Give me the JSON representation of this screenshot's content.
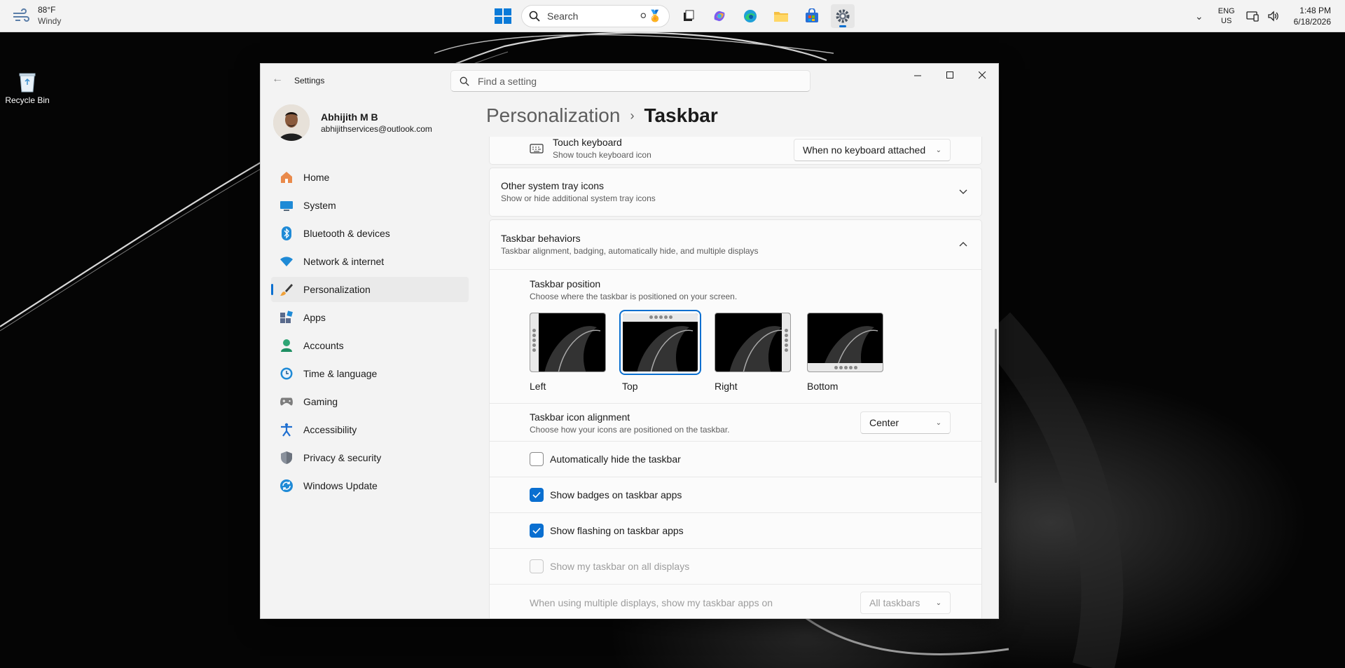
{
  "taskbar": {
    "weather": {
      "temp": "88°F",
      "condition": "Windy",
      "icon": "wind-icon"
    },
    "search_label": "Search",
    "apps": [
      "start-icon",
      "file-viewer-icon",
      "copilot-icon",
      "edge-icon",
      "file-explorer-icon",
      "store-icon",
      "settings-icon"
    ],
    "language": {
      "line1": "ENG",
      "line2": "US"
    },
    "clock": {
      "time": "1:48 PM",
      "date": "6/18/2026"
    }
  },
  "desktop": {
    "recycle_bin_label": "Recycle Bin"
  },
  "window": {
    "app_title": "Settings",
    "search_placeholder": "Find a setting"
  },
  "profile": {
    "name": "Abhijith M B",
    "email": "abhijithservices@outlook.com"
  },
  "nav": {
    "items": [
      {
        "label": "Home",
        "icon": "home-icon",
        "color": "#e66b2b"
      },
      {
        "label": "System",
        "icon": "system-icon",
        "color": "#1f8ad6"
      },
      {
        "label": "Bluetooth & devices",
        "icon": "bluetooth-icon",
        "color": "#1f8ad6"
      },
      {
        "label": "Network & internet",
        "icon": "wifi-icon",
        "color": "#1f8ad6"
      },
      {
        "label": "Personalization",
        "icon": "brush-icon",
        "color": "#e89a3a"
      },
      {
        "label": "Apps",
        "icon": "apps-icon",
        "color": "#5a6b8c"
      },
      {
        "label": "Accounts",
        "icon": "accounts-icon",
        "color": "#2ea574"
      },
      {
        "label": "Time & language",
        "icon": "clock-icon",
        "color": "#1f8ad6"
      },
      {
        "label": "Gaming",
        "icon": "gamepad-icon",
        "color": "#7d7d7d"
      },
      {
        "label": "Accessibility",
        "icon": "accessibility-icon",
        "color": "#1f6fd0"
      },
      {
        "label": "Privacy & security",
        "icon": "shield-icon",
        "color": "#7d8591"
      },
      {
        "label": "Windows Update",
        "icon": "update-icon",
        "color": "#1f8ad6"
      }
    ],
    "selected_index": 4
  },
  "breadcrumb": {
    "parent": "Personalization",
    "current": "Taskbar"
  },
  "touch_keyboard": {
    "title": "Touch keyboard",
    "subtitle": "Show touch keyboard icon",
    "value": "When no keyboard attached"
  },
  "other_tray": {
    "title": "Other system tray icons",
    "subtitle": "Show or hide additional system tray icons"
  },
  "behaviors": {
    "title": "Taskbar behaviors",
    "subtitle": "Taskbar alignment, badging, automatically hide, and multiple displays",
    "position": {
      "title": "Taskbar position",
      "subtitle": "Choose where the taskbar is positioned on your screen.",
      "options": [
        "Left",
        "Top",
        "Right",
        "Bottom"
      ],
      "selected": "Top"
    },
    "alignment": {
      "title": "Taskbar icon alignment",
      "subtitle": "Choose how your icons are positioned on the taskbar.",
      "value": "Center"
    },
    "auto_hide": {
      "label": "Automatically hide the taskbar",
      "checked": false
    },
    "badges": {
      "label": "Show badges on taskbar apps",
      "checked": true
    },
    "flashing": {
      "label": "Show flashing on taskbar apps",
      "checked": true
    },
    "all_displays": {
      "label": "Show my taskbar on all displays",
      "checked": false,
      "disabled": true
    },
    "multi_display": {
      "label": "When using multiple displays, show my taskbar apps on",
      "value": "All taskbars",
      "disabled": true
    }
  }
}
